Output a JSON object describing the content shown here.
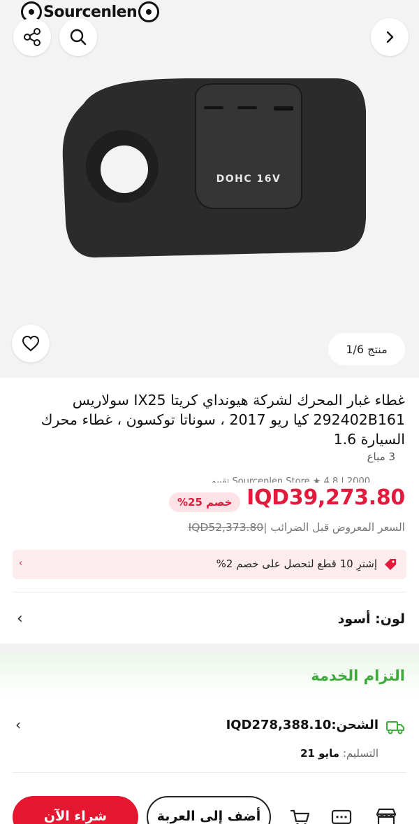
{
  "gallery": {
    "watermark": "Sourcenlen",
    "counter": "منتج 1/6",
    "product_badge": "DOHC 16V",
    "icons": [
      "share-icon",
      "search-icon",
      "chevron-right-icon",
      "heart-icon"
    ]
  },
  "product": {
    "title": "غطاء غبار المحرك لشركة هيونداي كريتا IX25 سولاريس 292402B161 كيا ريو 2017 ، سوناتا توكسون ، غطاء محرك السيارة 1.6",
    "sold": "3 مباع",
    "cut_text": "Sourcenlen Store ★ 4.8 | 2000 تقييم",
    "price": "IQD39,273.80",
    "discount": "خصم 25%",
    "old_price": "IQD52,373.80",
    "old_price_note": "السعر المعروض قبل الضرائب",
    "promo": "إشترِ 10 قطع لتحصل على خصم 2%",
    "color_label": "لون: أسود"
  },
  "service": {
    "title": "التزام الخدمة",
    "shipping_label": "الشحن:",
    "shipping_value": "IQD278,388.10",
    "delivery_label": "التسليم:",
    "delivery_value": "مايو 21"
  },
  "bottom_bar": {
    "buy_now": "شراء الآن",
    "add_to_cart": "أضف إلى العربة"
  },
  "colors": {
    "accent_red": "#e21b3c",
    "service_green": "#3eab3a"
  }
}
